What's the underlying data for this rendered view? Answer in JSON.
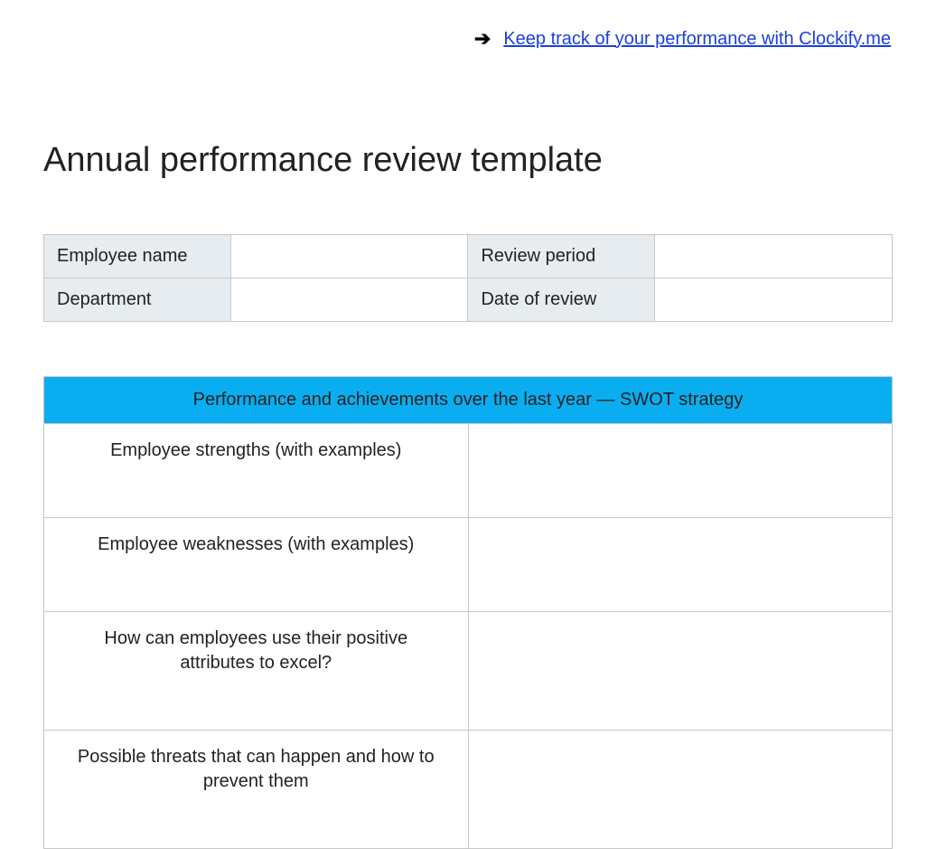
{
  "header": {
    "link_text": "Keep track of your performance with Clockify.me"
  },
  "title": "Annual performance review template",
  "info_table": {
    "rows": [
      {
        "label1": "Employee name",
        "value1": "",
        "label2": "Review period",
        "value2": ""
      },
      {
        "label1": "Department",
        "value1": "",
        "label2": "Date of review",
        "value2": ""
      }
    ]
  },
  "swot": {
    "header": "Performance and achievements over the last year — SWOT strategy",
    "rows": [
      {
        "question": "Employee strengths (with examples)",
        "answer": ""
      },
      {
        "question": "Employee weaknesses (with examples)",
        "answer": ""
      },
      {
        "question": "How can employees use their positive attributes to excel?",
        "answer": ""
      },
      {
        "question": "Possible threats that can happen and how to prevent them",
        "answer": ""
      }
    ]
  }
}
